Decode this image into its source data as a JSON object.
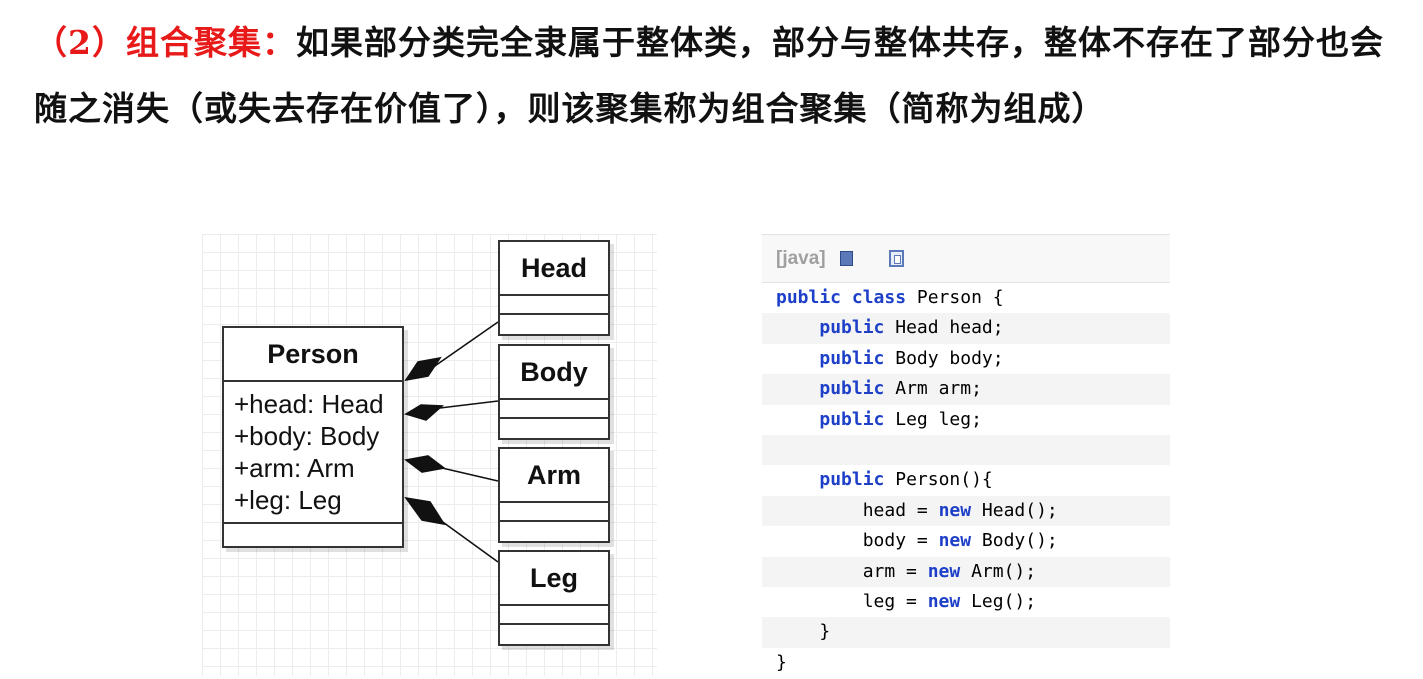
{
  "intro": {
    "tag": "（2）组合聚集：",
    "text": "如果部分类完全隶属于整体类，部分与整体共存，整体不存在了部分也会随之消失（或失去存在价值了），则该聚集称为组合聚集（简称为组成）"
  },
  "uml": {
    "person": {
      "name": "Person",
      "attributes": [
        "+head: Head",
        "+body: Body",
        "+arm: Arm",
        "+leg: Leg"
      ]
    },
    "parts": [
      "Head",
      "Body",
      "Arm",
      "Leg"
    ]
  },
  "code": {
    "language": "[java]",
    "lines": [
      [
        [
          "kw",
          "public class"
        ],
        [
          "t",
          " Person {"
        ]
      ],
      [
        [
          "t",
          "    "
        ],
        [
          "kw",
          "public"
        ],
        [
          "t",
          " Head head;"
        ]
      ],
      [
        [
          "t",
          "    "
        ],
        [
          "kw",
          "public"
        ],
        [
          "t",
          " Body body;"
        ]
      ],
      [
        [
          "t",
          "    "
        ],
        [
          "kw",
          "public"
        ],
        [
          "t",
          " Arm arm;"
        ]
      ],
      [
        [
          "t",
          "    "
        ],
        [
          "kw",
          "public"
        ],
        [
          "t",
          " Leg leg;"
        ]
      ],
      [
        [
          "t",
          ""
        ]
      ],
      [
        [
          "t",
          "    "
        ],
        [
          "kw",
          "public"
        ],
        [
          "t",
          " Person(){"
        ]
      ],
      [
        [
          "t",
          "        head = "
        ],
        [
          "kw",
          "new"
        ],
        [
          "t",
          " Head();"
        ]
      ],
      [
        [
          "t",
          "        body = "
        ],
        [
          "kw",
          "new"
        ],
        [
          "t",
          " Body();"
        ]
      ],
      [
        [
          "t",
          "        arm = "
        ],
        [
          "kw",
          "new"
        ],
        [
          "t",
          " Arm();"
        ]
      ],
      [
        [
          "t",
          "        leg = "
        ],
        [
          "kw",
          "new"
        ],
        [
          "t",
          " Leg();"
        ]
      ],
      [
        [
          "t",
          "    }"
        ]
      ],
      [
        [
          "t",
          "}"
        ]
      ]
    ]
  }
}
